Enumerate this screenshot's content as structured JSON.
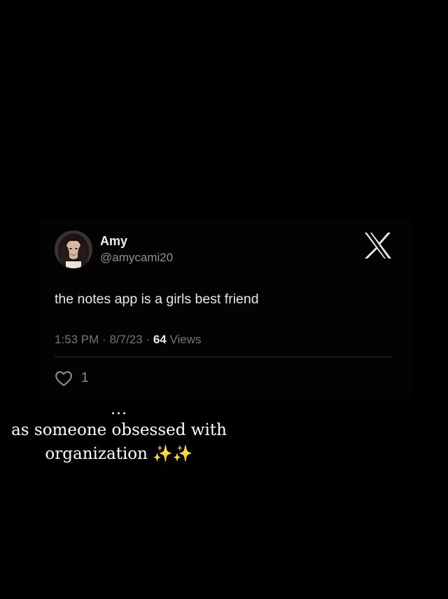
{
  "tweet": {
    "display_name": "Amy",
    "handle": "@amycami20",
    "text": "the notes app is a girls best friend",
    "time": "1:53 PM",
    "date": "8/7/23",
    "views_count": "64",
    "views_label": "Views",
    "likes": "1"
  },
  "caption": {
    "ellipsis": "...",
    "line1": "as someone obsessed with",
    "line2": "organization",
    "emoji": "✨✨"
  },
  "colors": {
    "background": "#000000",
    "text": "#e7e9ea",
    "muted": "#71767b",
    "divider": "#2f3336"
  },
  "icons": {
    "brand": "x-logo-icon",
    "like": "heart-icon"
  }
}
